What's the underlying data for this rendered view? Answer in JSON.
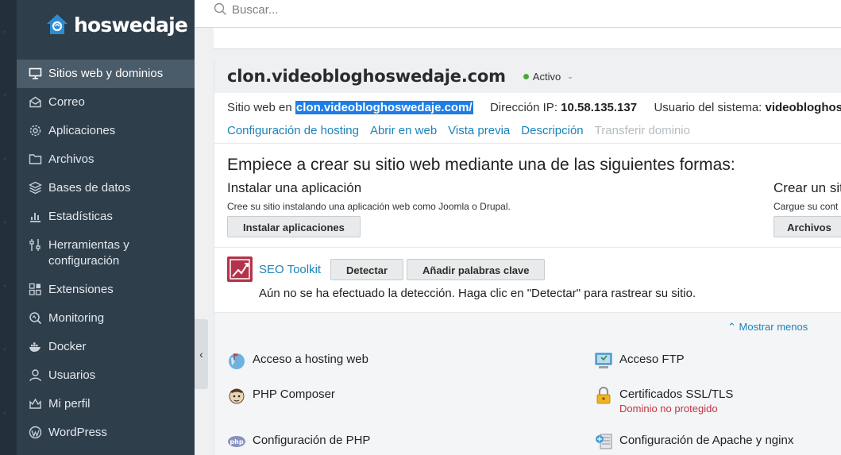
{
  "brand": {
    "name": "hoswedaje",
    "logo_icon": "house-icon"
  },
  "search": {
    "placeholder": "Buscar..."
  },
  "sidebar": {
    "items": [
      {
        "label": "Sitios web y dominios",
        "icon": "monitor-icon",
        "active": true
      },
      {
        "label": "Correo",
        "icon": "mail-icon"
      },
      {
        "label": "Aplicaciones",
        "icon": "gear-icon"
      },
      {
        "label": "Archivos",
        "icon": "folder-icon"
      },
      {
        "label": "Bases de datos",
        "icon": "database-icon"
      },
      {
        "label": "Estadísticas",
        "icon": "bar-chart-icon"
      },
      {
        "label": "Herramientas y configuración",
        "icon": "tools-icon"
      },
      {
        "label": "Extensiones",
        "icon": "extensions-icon"
      },
      {
        "label": "Monitoring",
        "icon": "monitoring-icon"
      },
      {
        "label": "Docker",
        "icon": "docker-icon"
      },
      {
        "label": "Usuarios",
        "icon": "user-icon"
      },
      {
        "label": "Mi perfil",
        "icon": "profile-icon"
      },
      {
        "label": "WordPress",
        "icon": "wordpress-icon"
      }
    ]
  },
  "domain": {
    "title": "clon.videobloghoswedaje.com",
    "status": "Activo",
    "status_color": "#4fa63a",
    "site_label": "Sitio web en",
    "site_link": "clon.videobloghoswedaje.com/",
    "ip_label": "Dirección IP:",
    "ip_value": "10.58.135.137",
    "user_label": "Usuario del sistema:",
    "user_value": "videobloghoswedaje",
    "links": [
      {
        "label": "Configuración de hosting",
        "enabled": true
      },
      {
        "label": "Abrir en web",
        "enabled": true
      },
      {
        "label": "Vista previa",
        "enabled": true
      },
      {
        "label": "Descripción",
        "enabled": true
      },
      {
        "label": "Transferir dominio",
        "enabled": false
      }
    ]
  },
  "start": {
    "title": "Empiece a crear su sitio web mediante una de las siguientes formas:",
    "app": {
      "title": "Instalar una aplicación",
      "desc": "Cree su sitio instalando una aplicación web como Joomla o Drupal.",
      "button": "Instalar aplicaciones"
    },
    "files": {
      "title": "Crear un sit",
      "desc": "Cargue su cont",
      "button": "Archivos"
    }
  },
  "seo": {
    "label": "SEO Toolkit",
    "detect_button": "Detectar",
    "keywords_button": "Añadir palabras clave",
    "message": "Aún no se ha efectuado la detección. Haga clic en \"Detectar\" para rastrear su sitio."
  },
  "tools": {
    "show_less": "Mostrar menos",
    "items": [
      {
        "label": "Acceso a hosting web",
        "icon": "globe-flag-icon"
      },
      {
        "label": "Acceso FTP",
        "icon": "ftp-icon"
      },
      {
        "label": "PHP Composer",
        "icon": "composer-icon"
      },
      {
        "label": "Certificados SSL/TLS",
        "icon": "lock-icon",
        "sub": "Dominio no protegido"
      },
      {
        "label": "Configuración de PHP",
        "icon": "php-icon"
      },
      {
        "label": "Configuración de Apache y nginx",
        "icon": "server-icon"
      }
    ]
  },
  "colors": {
    "sidebar": "#2f3e4b",
    "link": "#1b83b8",
    "danger": "#c23346"
  }
}
